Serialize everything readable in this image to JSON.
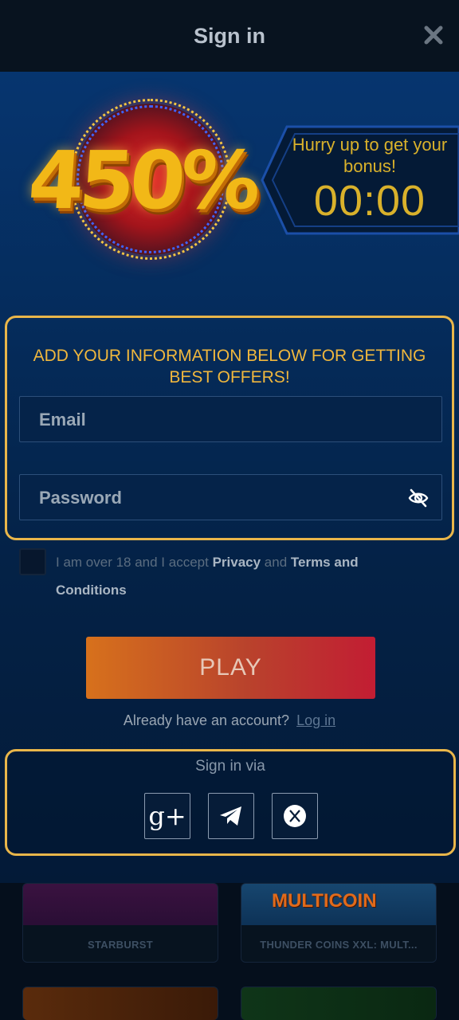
{
  "header": {
    "title": "Sign in",
    "close_icon": "close-icon"
  },
  "promo": {
    "percent": "450%",
    "hurry_text": "Hurry up to get your bonus!",
    "timer": "00:00"
  },
  "form": {
    "headline": "ADD YOUR INFORMATION BELOW FOR GETTING BEST OFFERS!",
    "email_placeholder": "Email",
    "password_placeholder": "Password",
    "password_toggle_icon": "eye-off-icon"
  },
  "consent": {
    "prefix": "I am over 18 and I accept ",
    "privacy": "Privacy",
    "and": " and ",
    "terms": "Terms and Conditions",
    "checked": false
  },
  "play_label": "PLAY",
  "login": {
    "question": "Already have an account?",
    "link": "Log in"
  },
  "social": {
    "label": "Sign in via",
    "providers": [
      {
        "name": "google-plus-icon",
        "glyph": "g+"
      },
      {
        "name": "telegram-icon"
      },
      {
        "name": "x-icon"
      }
    ]
  },
  "games": [
    {
      "name": "STARBURST"
    },
    {
      "name": "THUNDER COINS XXL: MULT...",
      "logo": "MULTICOIN"
    }
  ],
  "colors": {
    "accent_gold": "#e9b64a",
    "text_gold": "#d9b12b",
    "play_gradient_start": "#d7711c",
    "play_gradient_end": "#c21d33"
  }
}
